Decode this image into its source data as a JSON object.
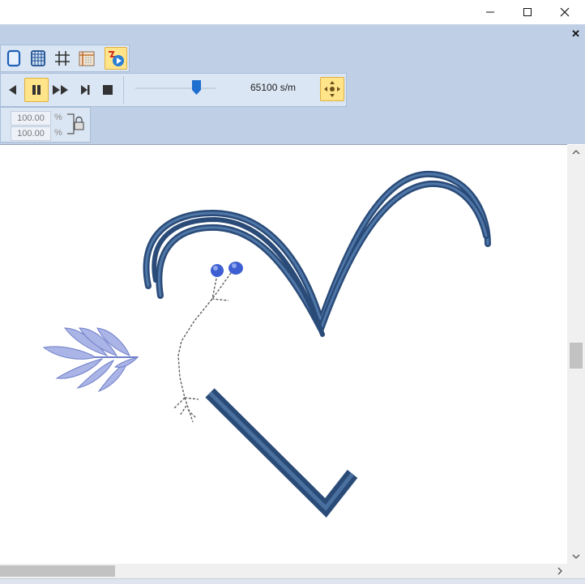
{
  "window": {
    "minimize_icon": "minimize-icon",
    "maximize_icon": "maximize-icon",
    "close_icon": "close-icon",
    "doc_close_label": "✕"
  },
  "toolbar": {
    "view_buttons": [
      "page-icon",
      "grid-dense-icon",
      "grid-icon",
      "hoop-grid-icon",
      "stitch-simulator-icon"
    ],
    "playback_buttons": [
      "rewind-icon",
      "pause-icon",
      "fast-forward-icon",
      "step-end-icon",
      "stop-icon"
    ],
    "speed_label": "65100 s/m",
    "speed_slider_fraction": 0.75,
    "move_button_icon": "move-arrows-icon"
  },
  "scale": {
    "width_value": "100.00",
    "height_value": "100.00",
    "unit": "%",
    "lock_icon": "lock-icon"
  },
  "colors": {
    "ribbon_bg": "#bfd0e6",
    "thread_dark_blue": "#2d4f7c",
    "thread_light_lavender": "#a6b2e6",
    "bead_blue": "#3e5fd1",
    "active_button": "#ffe48a"
  },
  "scrollbar": {
    "up_icon": "chevron-up-icon",
    "down_icon": "chevron-down-icon",
    "left_icon": "chevron-left-icon",
    "right_icon": "chevron-right-icon"
  }
}
